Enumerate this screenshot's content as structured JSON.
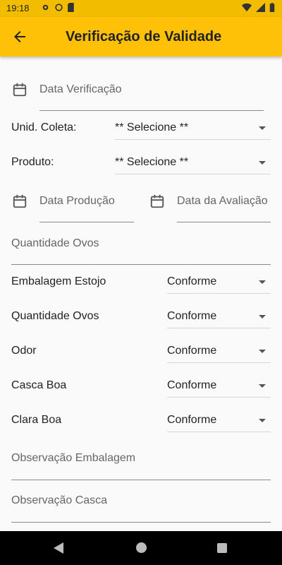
{
  "status_bar": {
    "time": "19:18"
  },
  "app_bar": {
    "title": "Verificação de Validade"
  },
  "form": {
    "data_verificacao": {
      "placeholder": "Data Verificação"
    },
    "unid_coleta": {
      "label": "Unid. Coleta:",
      "value": "** Selecione **"
    },
    "produto": {
      "label": "Produto:",
      "value": "** Selecione **"
    },
    "data_producao": {
      "placeholder": "Data Produção"
    },
    "data_avaliacao": {
      "placeholder": "Data da Avaliação"
    },
    "quantidade_ovos_input": {
      "placeholder": "Quantidade Ovos"
    },
    "checks": [
      {
        "label": "Embalagem Estojo",
        "value": "Conforme"
      },
      {
        "label": "Quantidade Ovos",
        "value": "Conforme"
      },
      {
        "label": "Odor",
        "value": "Conforme"
      },
      {
        "label": "Casca Boa",
        "value": "Conforme"
      },
      {
        "label": "Clara Boa",
        "value": "Conforme"
      }
    ],
    "observacao_embalagem": {
      "placeholder": "Observação Embalagem"
    },
    "observacao_casca": {
      "placeholder": "Observação Casca"
    }
  },
  "colors": {
    "appbar": "#ffc107",
    "statusbar": "#f2bd00"
  }
}
